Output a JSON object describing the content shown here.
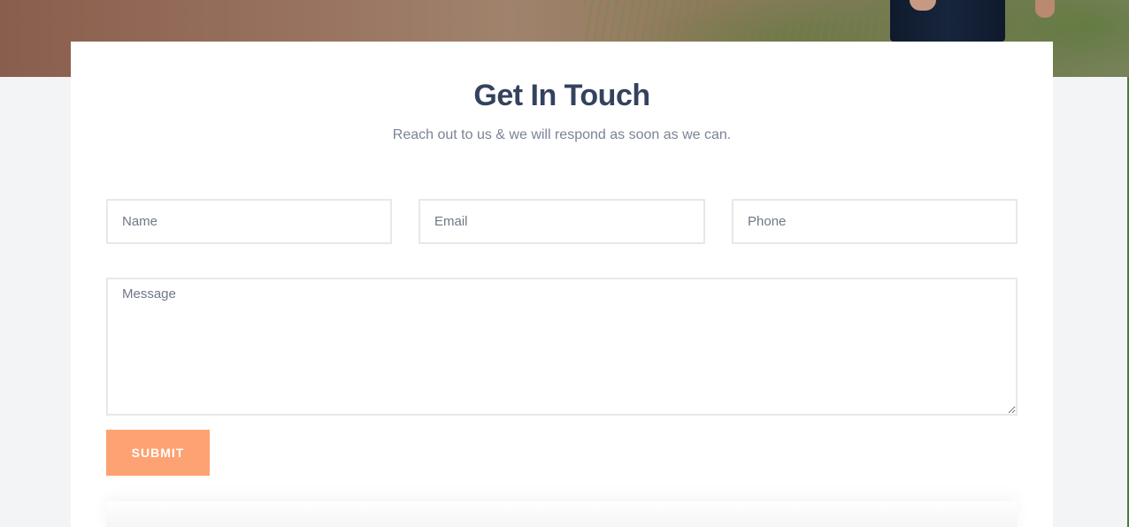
{
  "contact": {
    "title": "Get In Touch",
    "subtitle": "Reach out to us & we will respond as soon as we can.",
    "fields": {
      "name_placeholder": "Name",
      "email_placeholder": "Email",
      "phone_placeholder": "Phone",
      "message_placeholder": "Message"
    },
    "submit_label": "SUBMIT"
  },
  "colors": {
    "title": "#34425e",
    "subtitle": "#7a8396",
    "submit_bg": "#fda272",
    "field_border": "#e6e8ea",
    "page_bg": "#f2f4f5"
  }
}
